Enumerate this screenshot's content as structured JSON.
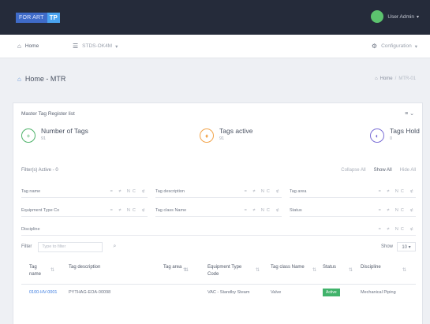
{
  "topbar": {
    "logo_text": "FOR ART",
    "logo_badge": "TP",
    "user_name": "User Admin",
    "user_caret": "▾"
  },
  "nav": {
    "home": "Home",
    "project": "STDS-OK4M",
    "project_caret": "▾",
    "config": "Configuration",
    "config_caret": "▾"
  },
  "page": {
    "title": "Home - MTR",
    "breadcrumb_home": "Home",
    "breadcrumb_sep": "/",
    "breadcrumb_current": "MTR-01"
  },
  "card": {
    "title": "Master Tag Register list",
    "tools": "≡ ⌄"
  },
  "stats": [
    {
      "label": "Number of Tags",
      "value": "91",
      "color": "#4fb36b",
      "glyph": "+"
    },
    {
      "label": "Tags active",
      "value": "91",
      "color": "#f2a44b",
      "glyph": "♦"
    },
    {
      "label": "Tags Hold",
      "value": "0",
      "color": "#7b6fd6",
      "glyph": "◐"
    }
  ],
  "filters": {
    "active_label": "Filter(s) Active - 0",
    "collapse_all": "Collapse All",
    "show_all": "Show All",
    "hide_all": "Hide All",
    "ops": "= ≠ NC ⊄",
    "fields": [
      "Tag name",
      "Tag description",
      "Tag area",
      "Equipment Type Co",
      "Tag class Name",
      "Status",
      "Discipline"
    ]
  },
  "search": {
    "label": "Filter",
    "placeholder": "Type to filter",
    "show_label": "Show",
    "show_value": "10 ▾"
  },
  "table": {
    "headers": [
      "Tag name",
      "Tag description",
      "Tag area",
      "Equipment Type Code",
      "Tag class Name",
      "Status",
      "Discipline"
    ],
    "row": {
      "tag_name": "0100-HV-0001",
      "description": "PYTHAG-EOA-00098",
      "area": "",
      "equipment": "VAC - Standby Steam",
      "tag_class": "Valve",
      "status": "Active",
      "discipline": "Mechanical Piping"
    }
  }
}
